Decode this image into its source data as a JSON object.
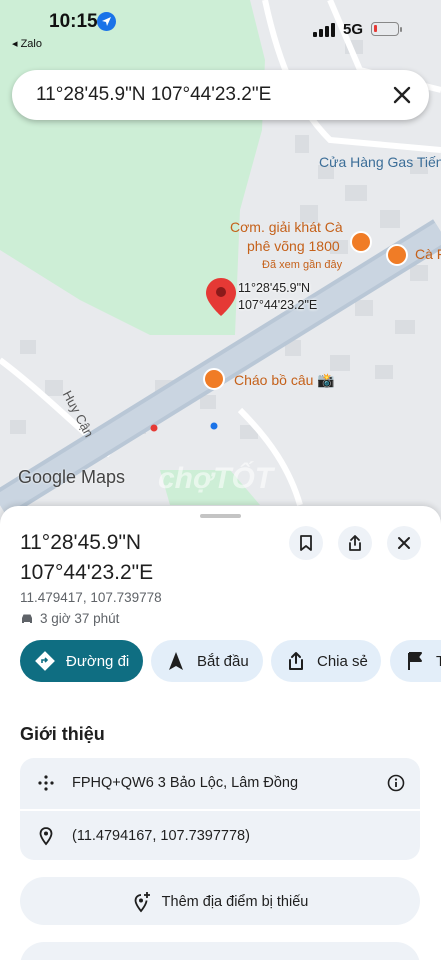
{
  "status_bar": {
    "time": "10:15",
    "back_app": "◂ Zalo",
    "network": "5G"
  },
  "search": {
    "query": "11°28'45.9\"N 107°44'23.2\"E"
  },
  "map": {
    "labels": {
      "gas_store": "Cửa Hàng Gas Tiến",
      "cafe_line1": "Cơm. giải khát Cà",
      "cafe_line2": "phê võng 1800",
      "cafe_sub": "Đã xem gần đây",
      "cafe2": "Cà F",
      "pigeon": "Cháo bồ câu 📸",
      "street": "Huy Cận",
      "pin_line1": "11°28'45.9\"N",
      "pin_line2": "107°44'23.2\"E"
    },
    "logo": "Google Maps",
    "watermark": "chợTỐT"
  },
  "place": {
    "title_line1": "11°28'45.9\"N",
    "title_line2": "107°44'23.2\"E",
    "decimal_coords": "11.479417, 107.739778",
    "drive_time": "3 giờ 37 phút"
  },
  "actions": {
    "directions": "Đường đi",
    "start": "Bắt đầu",
    "share": "Chia sẻ",
    "flag_partial": "T"
  },
  "about": {
    "title": "Giới thiệu",
    "plus_code": "FPHQ+QW6 3 Bảo Lộc, Lâm Đồng",
    "coords": "(11.4794167, 107.7397778)"
  },
  "buttons": {
    "add_missing_place": "Thêm địa điểm bị thiếu"
  },
  "colors": {
    "primary_chip": "#0f6e82",
    "chip_bg": "#e3eef9",
    "pin": "#e53935",
    "poi": "#f07c26"
  }
}
